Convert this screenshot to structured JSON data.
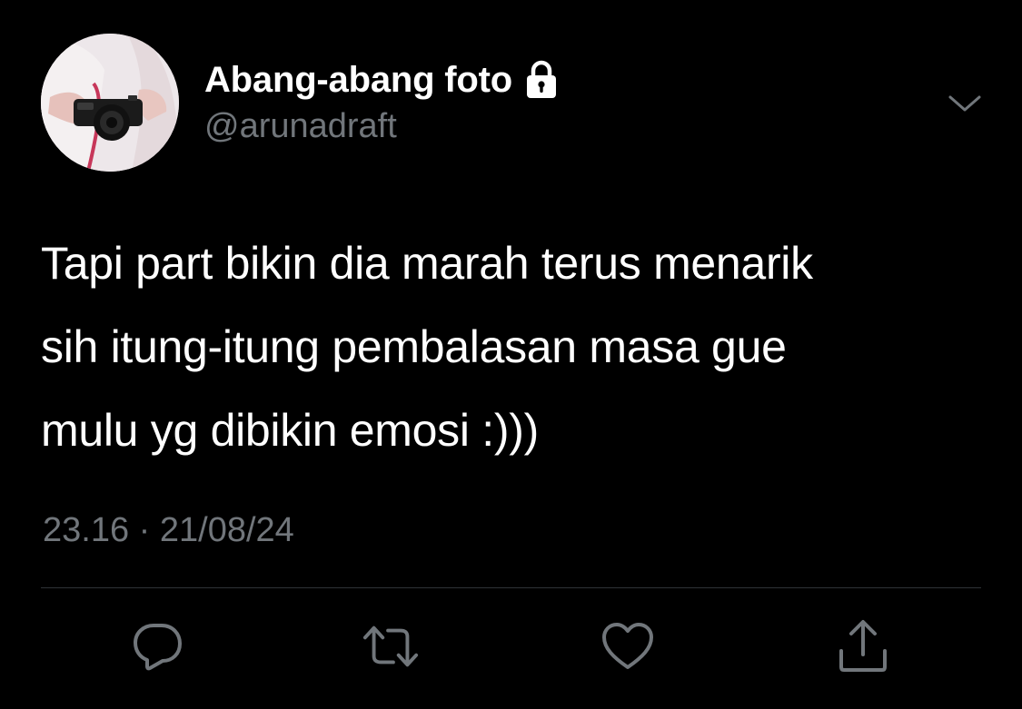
{
  "author": {
    "display_name": "Abang-abang foto",
    "handle": "@arunadraft",
    "protected_icon": "lock-icon"
  },
  "tweet": {
    "text": "Tapi part bikin dia marah terus menarik\nsih itung-itung pembalasan masa gue\nmulu yg dibikin emosi :)))",
    "timestamp": "23.16 · 21/08/24"
  },
  "actions": [
    {
      "name": "reply",
      "icon": "reply-icon"
    },
    {
      "name": "retweet",
      "icon": "retweet-icon"
    },
    {
      "name": "like",
      "icon": "heart-icon"
    },
    {
      "name": "share",
      "icon": "share-icon"
    }
  ],
  "colors": {
    "background": "#000000",
    "primary_text": "#ffffff",
    "secondary_text": "#71767b",
    "divider": "#2f3336"
  }
}
